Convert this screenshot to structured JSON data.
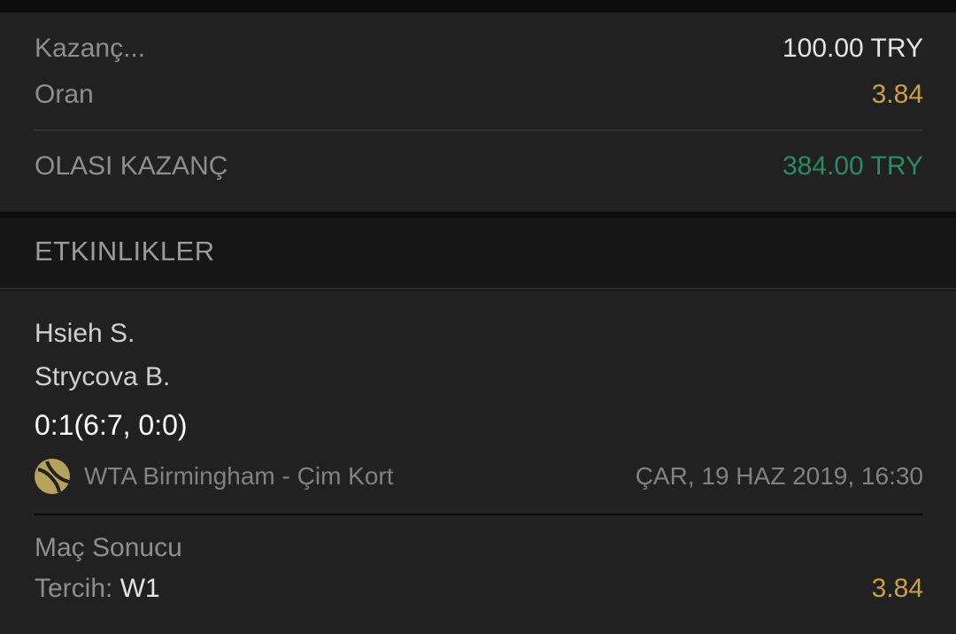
{
  "summary": {
    "stake_label": "Kazanç...",
    "stake_value": "100.00 TRY",
    "odds_label": "Oran",
    "odds_value": "3.84",
    "potential_label": "OLASI KAZANÇ",
    "potential_value": "384.00 TRY"
  },
  "events_section": {
    "title": "ETKINLIKLER"
  },
  "event": {
    "home": "Hsieh S.",
    "away": "Strycova B.",
    "score": "0:1(6:7, 0:0)",
    "sport_icon": "tennis-ball-icon",
    "league": "WTA Birmingham - Çim Kort",
    "datetime": "ÇAR, 19 HAZ 2019, 16:30",
    "market": "Maç Sonucu",
    "pick_label": "Tercih: ",
    "pick_value": "W1",
    "pick_odds": "3.84"
  },
  "colors": {
    "odds": "#c9a045",
    "win": "#2b8a66",
    "icon": "#b5a35c"
  }
}
